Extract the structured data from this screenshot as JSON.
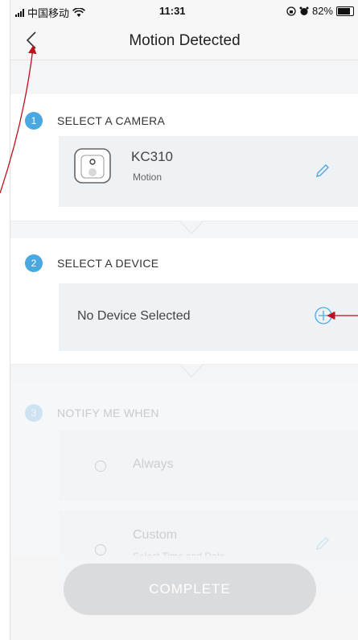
{
  "status_bar": {
    "carrier": "中国移动",
    "time": "11:31",
    "battery": "82%",
    "battery_level": 0.82
  },
  "nav": {
    "title": "Motion Detected",
    "back_icon": "chevron-left-icon"
  },
  "sections": [
    {
      "number": "1",
      "title": "SELECT A CAMERA"
    },
    {
      "number": "2",
      "title": "SELECT A DEVICE"
    },
    {
      "number": "3",
      "title": "NOTIFY ME WHEN"
    }
  ],
  "camera": {
    "name": "KC310",
    "subtitle": "Motion",
    "icon": "camera-icon",
    "edit_icon": "pencil-icon"
  },
  "device": {
    "placeholder": "No Device Selected",
    "add_icon": "plus-circle-icon"
  },
  "notify_options": [
    {
      "label": "Always"
    },
    {
      "label": "Custom",
      "sub": "Select Time and Date"
    }
  ],
  "complete_button": "COMPLETE",
  "colors": {
    "accent": "#4aa8e0",
    "annotation_arrow": "#c0101e"
  }
}
